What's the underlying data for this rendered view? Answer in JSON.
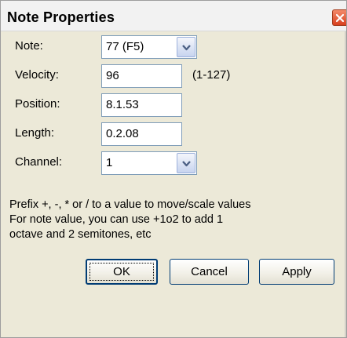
{
  "window": {
    "title": "Note Properties"
  },
  "fields": {
    "note": {
      "label": "Note:",
      "value": "77 (F5)"
    },
    "velocity": {
      "label": "Velocity:",
      "value": "96",
      "hint": "(1-127)"
    },
    "position": {
      "label": "Position:",
      "value": "8.1.53"
    },
    "length": {
      "label": "Length:",
      "value": "0.2.08"
    },
    "channel": {
      "label": "Channel:",
      "value": "1"
    }
  },
  "help": {
    "line1": "Prefix +, -, * or / to a value to move/scale values",
    "line2": "For note value, you can use +1o2 to add 1",
    "line3": "octave and 2 semitones, etc"
  },
  "buttons": {
    "ok": "OK",
    "cancel": "Cancel",
    "apply": "Apply"
  },
  "colors": {
    "dialog_background": "#ece9d8",
    "close_button": "#d8401f",
    "input_border": "#7f9db9"
  }
}
